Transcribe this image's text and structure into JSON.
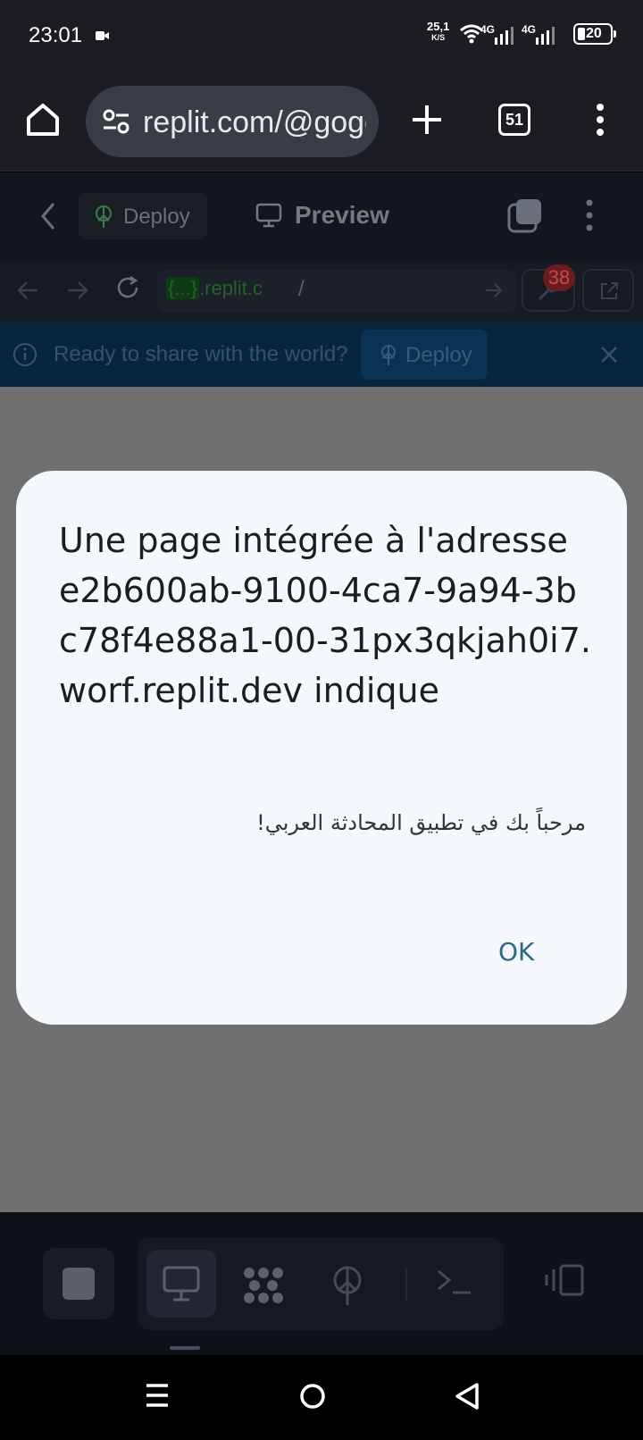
{
  "status_bar": {
    "time": "23:01",
    "net_speed_value": "25,1",
    "net_speed_unit": "K/S",
    "signal1_label": "4G",
    "signal2_label": "4G",
    "battery": "20"
  },
  "browser": {
    "url": "replit.com/@gogo",
    "tab_count": "51"
  },
  "replit_header": {
    "deploy_label": "Deploy",
    "preview_label": "Preview"
  },
  "toolbar": {
    "address_tag": "{...}",
    "address_host": ".replit.c",
    "address_path": "/",
    "tools_badge": "38"
  },
  "banner": {
    "message": "Ready to share with the world?",
    "deploy_label": "Deploy"
  },
  "dialog": {
    "title": "Une page intégrée à l'adresse e2b600ab-9100-4ca7-9a94-3bc78f4e88a1-00-31px3qkjah0i7.worf.replit.dev indique",
    "message": "مرحباً بك في تطبيق المحادثة العربي!",
    "ok_label": "OK"
  },
  "colors": {
    "accent_ok": "#2d6985",
    "dialog_bg": "#f4f7fc",
    "banner_bg": "#06263f",
    "badge_bg": "#6b1c1f"
  }
}
